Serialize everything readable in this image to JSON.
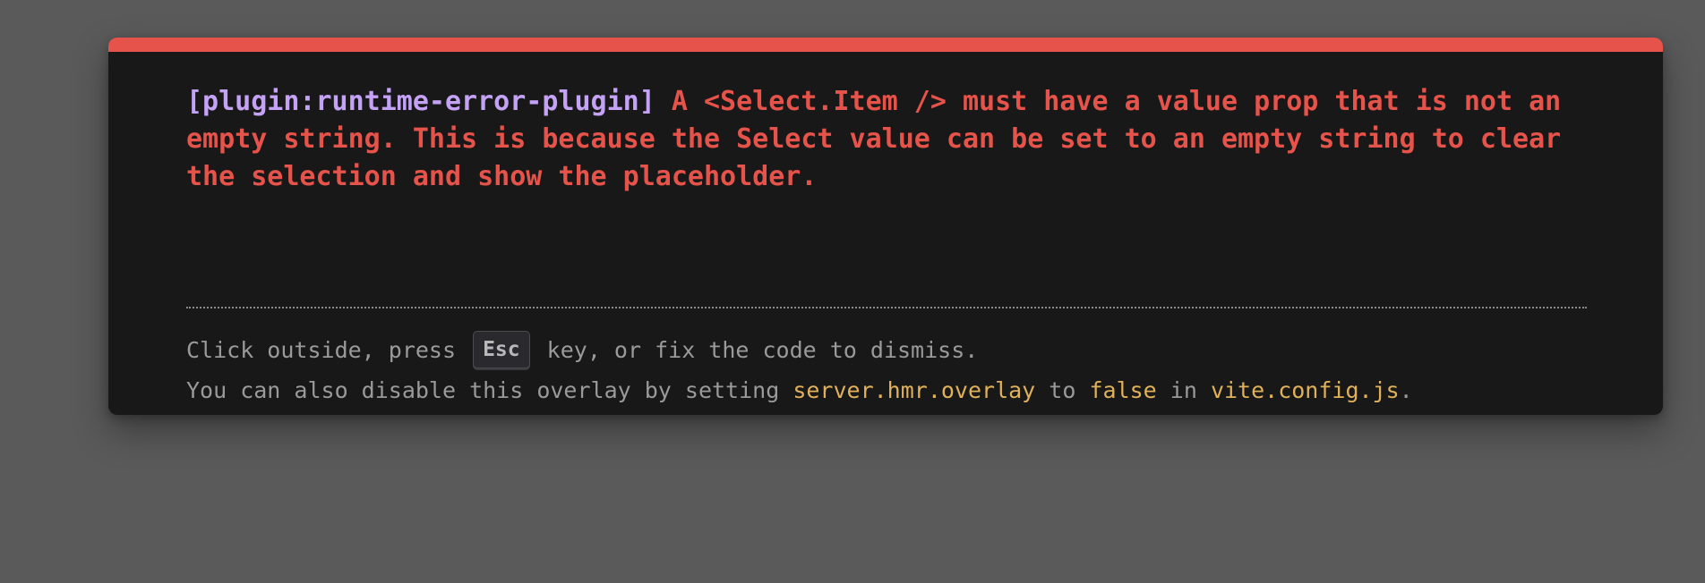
{
  "colors": {
    "backdrop": "#5a5a5a",
    "panel": "#181818",
    "accent_bar": "#e5534b",
    "error_text": "#e5534b",
    "plugin_text": "#c4a2f5",
    "tip_text": "#9a9a9a",
    "code_text": "#e0b15a"
  },
  "error": {
    "plugin": "[plugin:runtime-error-plugin]",
    "message": " A <Select.Item /> must have a value prop that is not an empty string. This is because the Select value can be set to an empty string to clear the selection and show the placeholder."
  },
  "tip": {
    "line1_before": "Click outside, press ",
    "key_label": "Esc",
    "line1_after": " key, or fix the code to dismiss.",
    "line2_part1": "You can also disable this overlay by setting ",
    "line2_code1": "server.hmr.overlay",
    "line2_part2": " to ",
    "line2_code2": "false",
    "line2_part3": " in ",
    "line2_code3": "vite.config.js",
    "line2_part4": "."
  }
}
